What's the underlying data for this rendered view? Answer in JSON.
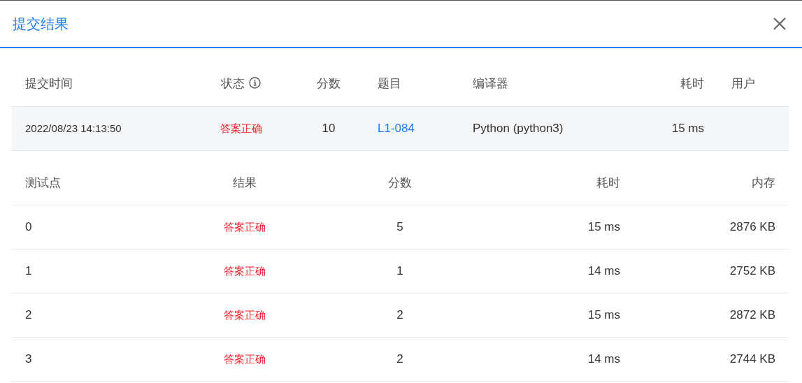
{
  "dialog": {
    "title": "提交结果"
  },
  "submission": {
    "columns": [
      {
        "label": "提交时间"
      },
      {
        "label": "状态",
        "info_icon": true
      },
      {
        "label": "分数"
      },
      {
        "label": "题目"
      },
      {
        "label": "编译器"
      },
      {
        "label": "耗时"
      },
      {
        "label": "用户"
      }
    ],
    "row": {
      "time": "2022/08/23 14:13:50",
      "status": {
        "text": "答案正确",
        "kind": "accepted"
      },
      "score": "10",
      "problem": "L1-084",
      "compiler": "Python (python3)",
      "elapsed": "15 ms"
    }
  },
  "testcases": {
    "columns": [
      "测试点",
      "结果",
      "分数",
      "耗时",
      "内存"
    ],
    "rows": [
      {
        "id": "0",
        "result": {
          "text": "答案正确",
          "kind": "accepted"
        },
        "score": "5",
        "elapsed": "15 ms",
        "memory": "2876 KB"
      },
      {
        "id": "1",
        "result": {
          "text": "答案正确",
          "kind": "accepted"
        },
        "score": "1",
        "elapsed": "14 ms",
        "memory": "2752 KB"
      },
      {
        "id": "2",
        "result": {
          "text": "答案正确",
          "kind": "accepted"
        },
        "score": "2",
        "elapsed": "15 ms",
        "memory": "2872 KB"
      },
      {
        "id": "3",
        "result": {
          "text": "答案正确",
          "kind": "accepted"
        },
        "score": "2",
        "elapsed": "14 ms",
        "memory": "2744 KB"
      }
    ]
  }
}
